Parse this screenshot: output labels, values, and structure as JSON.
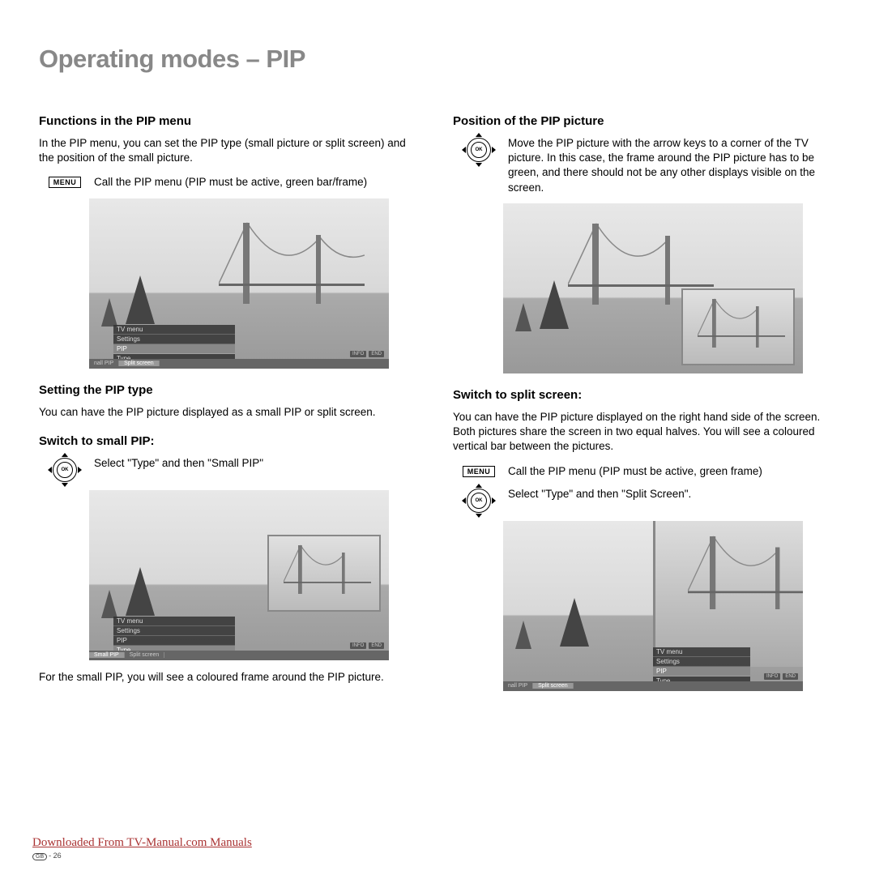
{
  "title": "Operating modes – PIP",
  "left": {
    "h1": "Functions in the PIP menu",
    "p1": "In the PIP menu, you can set the PIP type (small picture or split screen) and the position of the small picture.",
    "menu_label": "MENU",
    "instr1": "Call the PIP menu (PIP must be active, green bar/frame)",
    "h2": "Setting the PIP type",
    "p2": "You can have the PIP picture displayed as a small PIP or split screen.",
    "h3": "Switch to small PIP:",
    "instr2": "Select \"Type\" and then \"Small PIP\"",
    "p3": "For the small PIP, you will see a coloured frame around the PIP picture."
  },
  "right": {
    "h1": "Position of the PIP picture",
    "p1": "Move the PIP picture with the arrow keys to a corner of the TV picture. In this case, the frame around the PIP picture has to be green, and there should not be any other displays visible on the screen.",
    "h2": "Switch to split screen:",
    "p2": "You can have the PIP picture displayed on the right hand side of the screen. Both pictures share the screen in two equal halves. You will see a coloured vertical bar between the pictures.",
    "menu_label": "MENU",
    "instr1": "Call the PIP menu (PIP must be active, green frame)",
    "instr2": "Select \"Type\" and then \"Split Screen\"."
  },
  "osd": {
    "tv_menu": "TV menu",
    "settings": "Settings",
    "pip": "PIP",
    "type": "Type",
    "small_pip": "Small PIP",
    "split_screen": "Split screen",
    "nall_pip": "nall PIP",
    "info": "INFO",
    "end": "END"
  },
  "ok_label": "OK",
  "footer": {
    "link": "Downloaded From TV-Manual.com Manuals",
    "page_code": "GB",
    "page_num": "- 26"
  }
}
